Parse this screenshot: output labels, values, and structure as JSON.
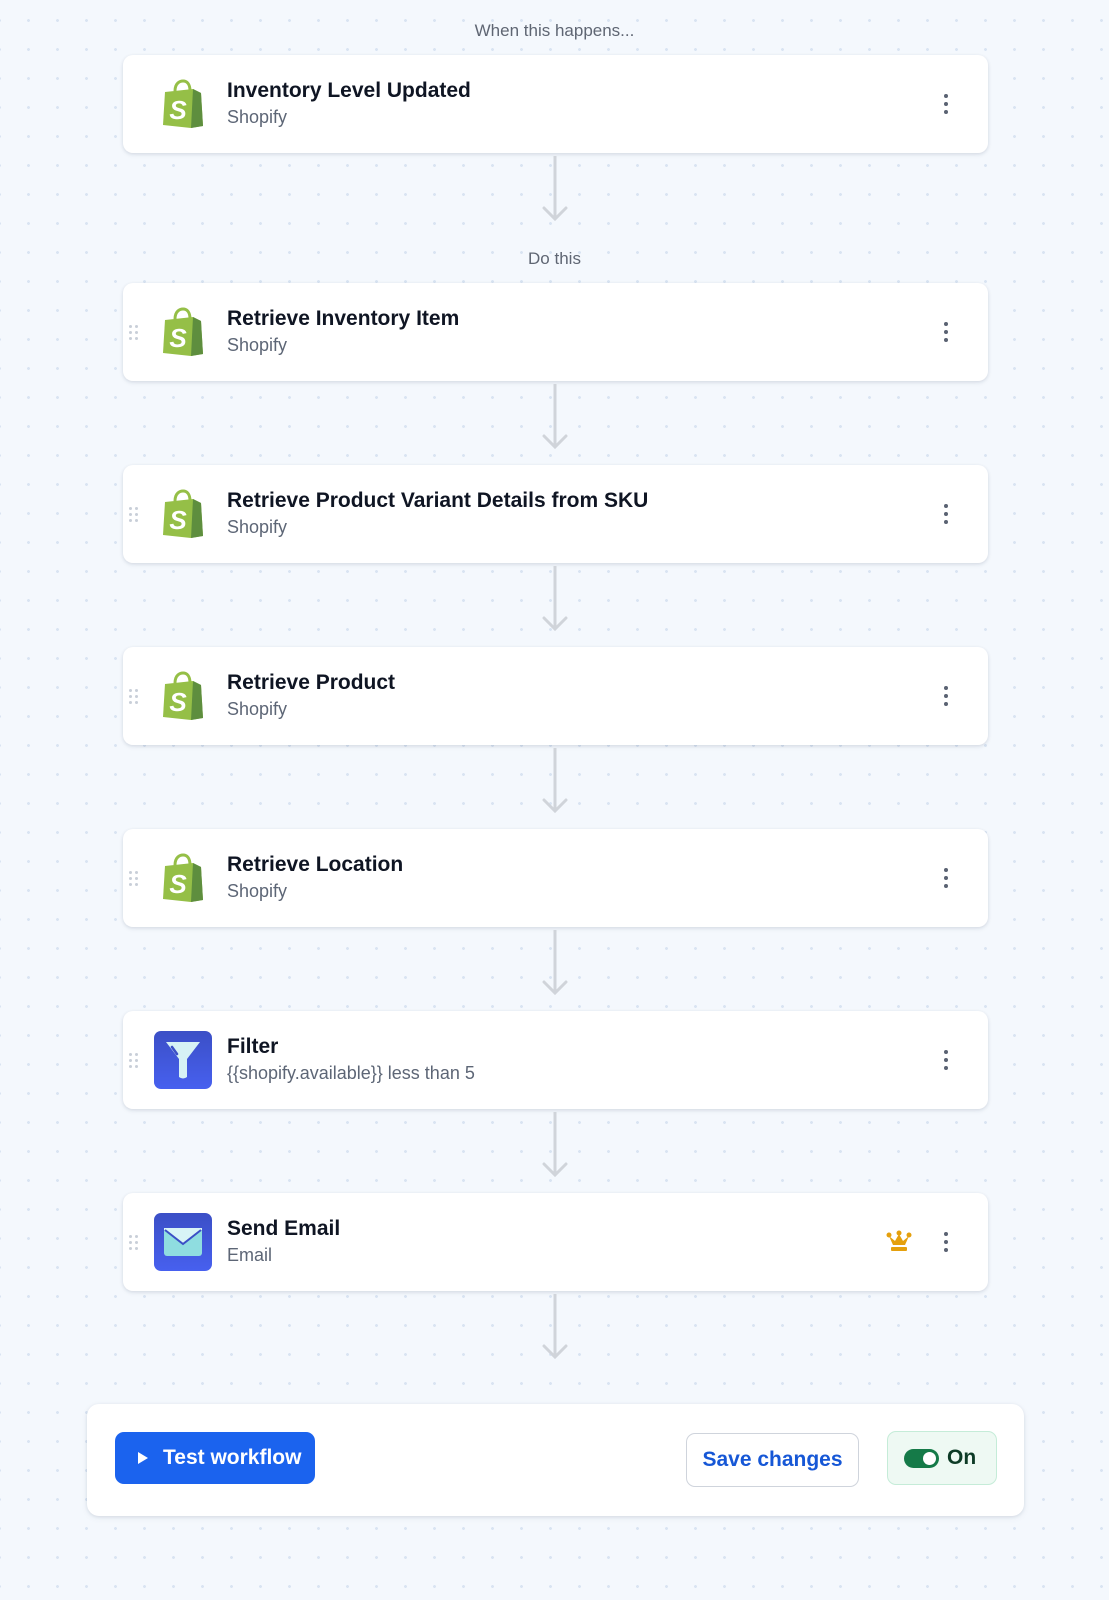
{
  "labels": {
    "trigger_section": "When this happens...",
    "actions_section": "Do this"
  },
  "trigger": {
    "title": "Inventory Level Updated",
    "app": "Shopify",
    "icon": "shopify-bag-icon"
  },
  "steps": [
    {
      "title": "Retrieve Inventory Item",
      "subtitle": "Shopify",
      "icon": "shopify-bag-icon"
    },
    {
      "title": "Retrieve Product Variant Details from SKU",
      "subtitle": "Shopify",
      "icon": "shopify-bag-icon"
    },
    {
      "title": "Retrieve Product",
      "subtitle": "Shopify",
      "icon": "shopify-bag-icon"
    },
    {
      "title": "Retrieve Location",
      "subtitle": "Shopify",
      "icon": "shopify-bag-icon"
    },
    {
      "title": "Filter",
      "subtitle": "{{shopify.available}} less than 5",
      "icon": "filter-funnel-icon"
    },
    {
      "title": "Send Email",
      "subtitle": "Email",
      "icon": "email-envelope-icon",
      "badge": "premium-crown-icon"
    }
  ],
  "footer": {
    "test_button": "Test workflow",
    "save_button": "Save changes",
    "toggle_label": "On",
    "toggle_state": true
  },
  "colors": {
    "primary": "#1b63ee",
    "shopify_green": "#95bf47",
    "toggle_on": "#157a48",
    "crown": "#e5a00d",
    "background": "#f4f8fd"
  }
}
